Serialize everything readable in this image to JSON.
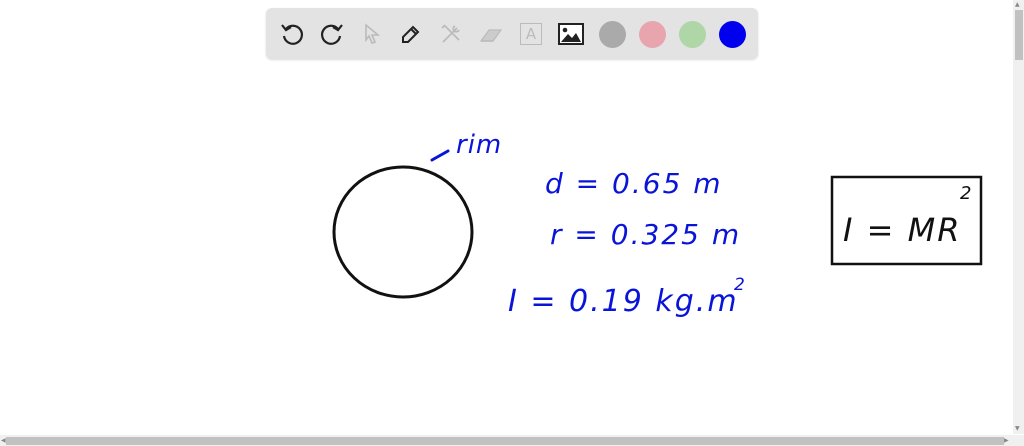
{
  "toolbar": {
    "tools": [
      {
        "icon": "undo-icon",
        "enabled": true
      },
      {
        "icon": "redo-icon",
        "enabled": true
      },
      {
        "icon": "select-pointer-icon",
        "enabled": false
      },
      {
        "icon": "pen-icon",
        "enabled": true
      },
      {
        "icon": "tools-icon",
        "enabled": false
      },
      {
        "icon": "eraser-icon",
        "enabled": false
      },
      {
        "icon": "text-box-icon",
        "enabled": false
      },
      {
        "icon": "image-icon",
        "enabled": true
      }
    ],
    "text_tool_glyph": "A",
    "colors": [
      "#aaaaaa",
      "#e8a5ad",
      "#aed6a7",
      "#0000ee"
    ],
    "selected_color": "#0000ee"
  },
  "canvas": {
    "ink_color": "#0a14d8",
    "label_rim": "rim",
    "eq_d": "d = 0.65 m",
    "eq_r": "r = 0.325 m",
    "eq_I": "I = 0.19 kg.m",
    "eq_I_exp": "2",
    "boxed_formula": "I = MR",
    "boxed_formula_exp": "2"
  }
}
